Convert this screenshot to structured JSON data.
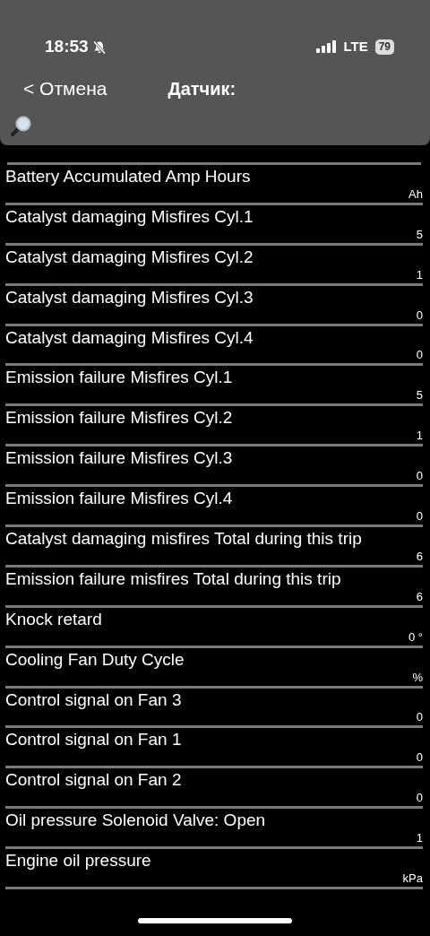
{
  "status_bar": {
    "time": "18:53",
    "silent": true,
    "network": "LTE",
    "battery": "79"
  },
  "nav": {
    "back": "< Отмена",
    "title": "Датчик:"
  },
  "sensors": [
    {
      "name": "Battery Accumulated Amp Hours",
      "value": "Ah"
    },
    {
      "name": "Catalyst damaging Misfires Cyl.1",
      "value": "5"
    },
    {
      "name": "Catalyst damaging Misfires Cyl.2",
      "value": "1"
    },
    {
      "name": "Catalyst damaging Misfires Cyl.3",
      "value": "0"
    },
    {
      "name": "Catalyst damaging Misfires Cyl.4",
      "value": "0"
    },
    {
      "name": "Emission failure Misfires Cyl.1",
      "value": "5"
    },
    {
      "name": "Emission failure Misfires Cyl.2",
      "value": "1"
    },
    {
      "name": "Emission failure Misfires Cyl.3",
      "value": "0"
    },
    {
      "name": "Emission failure Misfires Cyl.4",
      "value": "0"
    },
    {
      "name": "Catalyst damaging misfires Total during this trip",
      "value": "6"
    },
    {
      "name": "Emission failure misfires Total during this trip",
      "value": "6"
    },
    {
      "name": "Knock retard",
      "value": "0 °"
    },
    {
      "name": "Cooling Fan Duty Cycle",
      "value": "%"
    },
    {
      "name": "Control signal on Fan 3",
      "value": "0"
    },
    {
      "name": "Control signal on Fan 1",
      "value": "0"
    },
    {
      "name": "Control signal on Fan 2",
      "value": "0"
    },
    {
      "name": "Oil pressure Solenoid Valve: Open",
      "value": "1"
    },
    {
      "name": "Engine oil pressure",
      "value": "kPa"
    }
  ]
}
